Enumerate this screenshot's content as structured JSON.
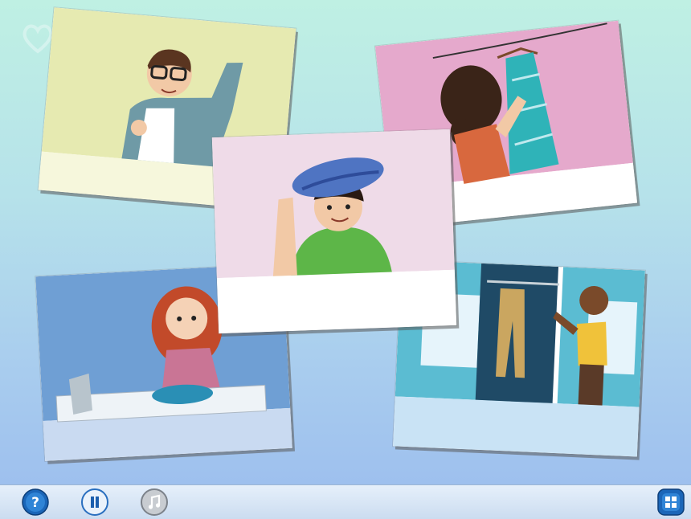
{
  "cards": [
    {
      "id": "boy-shirt",
      "caption": ""
    },
    {
      "id": "girl-dress",
      "caption": ""
    },
    {
      "id": "boy-cap",
      "caption": ""
    },
    {
      "id": "girl-wash",
      "caption": ""
    },
    {
      "id": "boy-closet",
      "caption": ""
    }
  ],
  "toolbar": {
    "help_icon": "question-icon",
    "pause_icon": "pause-icon",
    "music_icon": "music-note-icon",
    "menu_icon": "grid-menu-icon"
  },
  "colors": {
    "bg_top": "#bff0e3",
    "bg_bottom": "#9ec0ee",
    "card_yellow": "#e6eab1",
    "card_pink": "#e5a9cc",
    "card_lilac": "#efdbe8",
    "card_blue": "#6f9fd4",
    "card_teal": "#5bbcd2",
    "toolbar": "#cbdcf0"
  }
}
